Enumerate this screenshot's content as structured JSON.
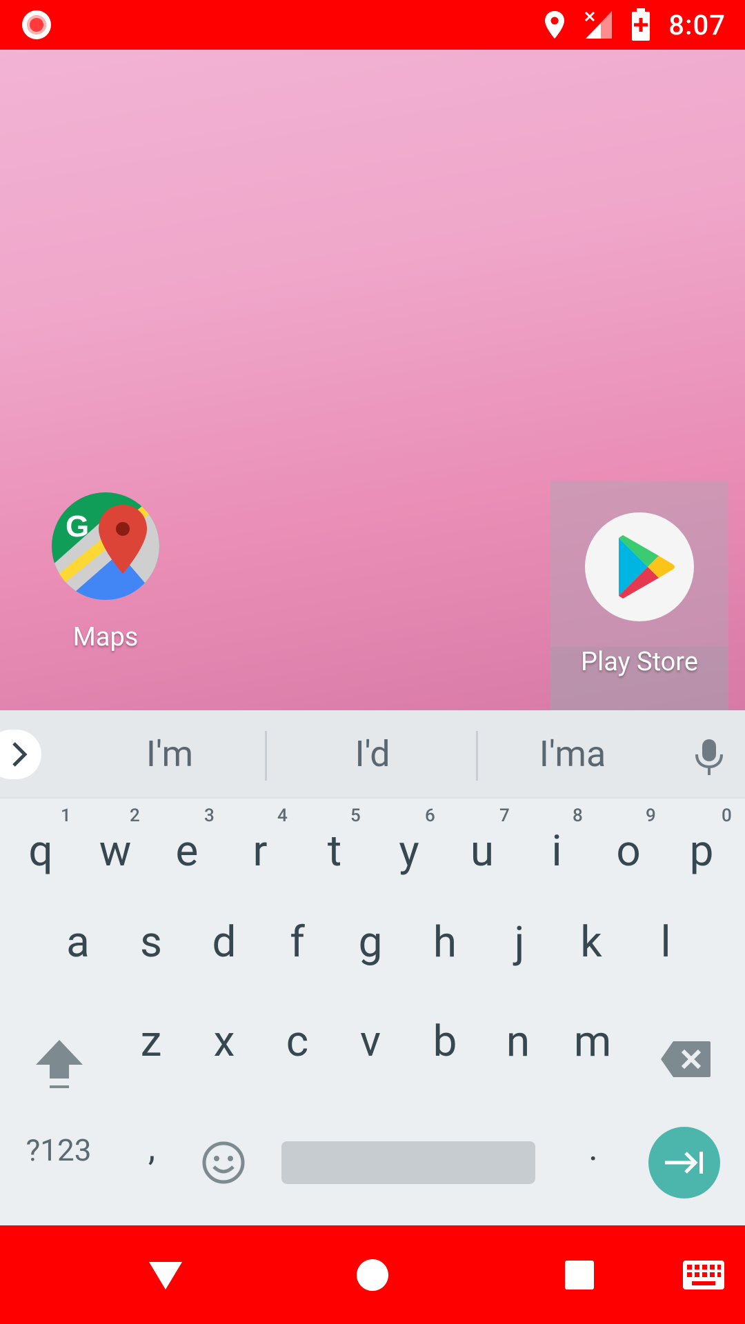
{
  "status_bar": {
    "time": "8:07",
    "icons": [
      "screen-record-icon",
      "location-icon",
      "signal-no-data-icon",
      "battery-charging-icon"
    ]
  },
  "home": {
    "apps": [
      {
        "label": "Maps",
        "icon": "google-maps-icon"
      },
      {
        "label": "Play Store",
        "icon": "play-store-icon",
        "selected": true
      }
    ]
  },
  "keyboard": {
    "suggestions": [
      "I'm",
      "I'd",
      "I'ma"
    ],
    "row1": [
      {
        "letter": "q",
        "hint": "1"
      },
      {
        "letter": "w",
        "hint": "2"
      },
      {
        "letter": "e",
        "hint": "3"
      },
      {
        "letter": "r",
        "hint": "4"
      },
      {
        "letter": "t",
        "hint": "5"
      },
      {
        "letter": "y",
        "hint": "6"
      },
      {
        "letter": "u",
        "hint": "7"
      },
      {
        "letter": "i",
        "hint": "8"
      },
      {
        "letter": "o",
        "hint": "9"
      },
      {
        "letter": "p",
        "hint": "0"
      }
    ],
    "row2": [
      "a",
      "s",
      "d",
      "f",
      "g",
      "h",
      "j",
      "k",
      "l"
    ],
    "row3": [
      "z",
      "x",
      "c",
      "v",
      "b",
      "n",
      "m"
    ],
    "symbols_label": "?123",
    "comma": ",",
    "period": ".",
    "accent_color": "#4db6ac"
  },
  "nav_bar": {
    "color": "#ff0000",
    "items": [
      "back-icon",
      "home-icon",
      "recents-icon",
      "keyboard-icon"
    ]
  }
}
